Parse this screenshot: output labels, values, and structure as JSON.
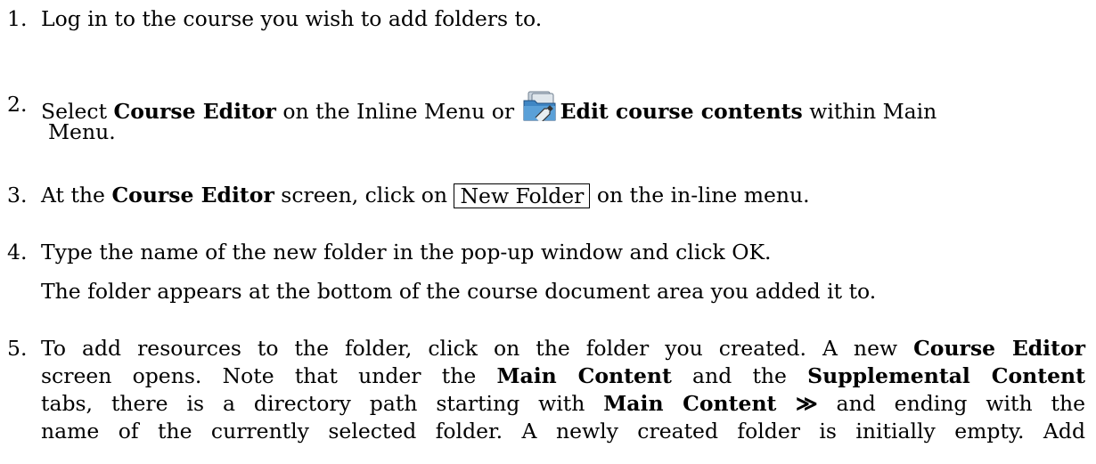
{
  "steps": [
    {
      "number": "1.",
      "text": "Log in to the course you wish to add folders to."
    },
    {
      "number": "2.",
      "pre": "Select ",
      "bold1": "Course Editor",
      "mid": " on the Inline Menu or ",
      "icon": "edit-course-contents-icon",
      "bold2": "Edit course contents",
      "post": " within Main",
      "line2": "Menu."
    },
    {
      "number": "3.",
      "pre": "At the ",
      "bold1": "Course Editor",
      "mid": " screen, click on ",
      "button": "New Folder",
      "post": " on the in-line menu."
    },
    {
      "number": "4.",
      "text": "Type the name of the new folder in the pop-up window and click OK.",
      "note": "The folder appears at the bottom of the course document area you added it to."
    },
    {
      "number": "5.",
      "s1": "To add resources to the folder, click on the folder you created. A new ",
      "b1": "Course Editor",
      "s2": "screen opens. Note that under the ",
      "b2": "Main Content",
      "s3": " and the ",
      "b3": "Supplemental Content",
      "s4": "tabs, there is a directory path starting with ",
      "b4": "Main Content ≫",
      "s5": " and ending with the",
      "s6": "name of the currently selected folder. A newly created folder is initially empty. Add"
    }
  ]
}
